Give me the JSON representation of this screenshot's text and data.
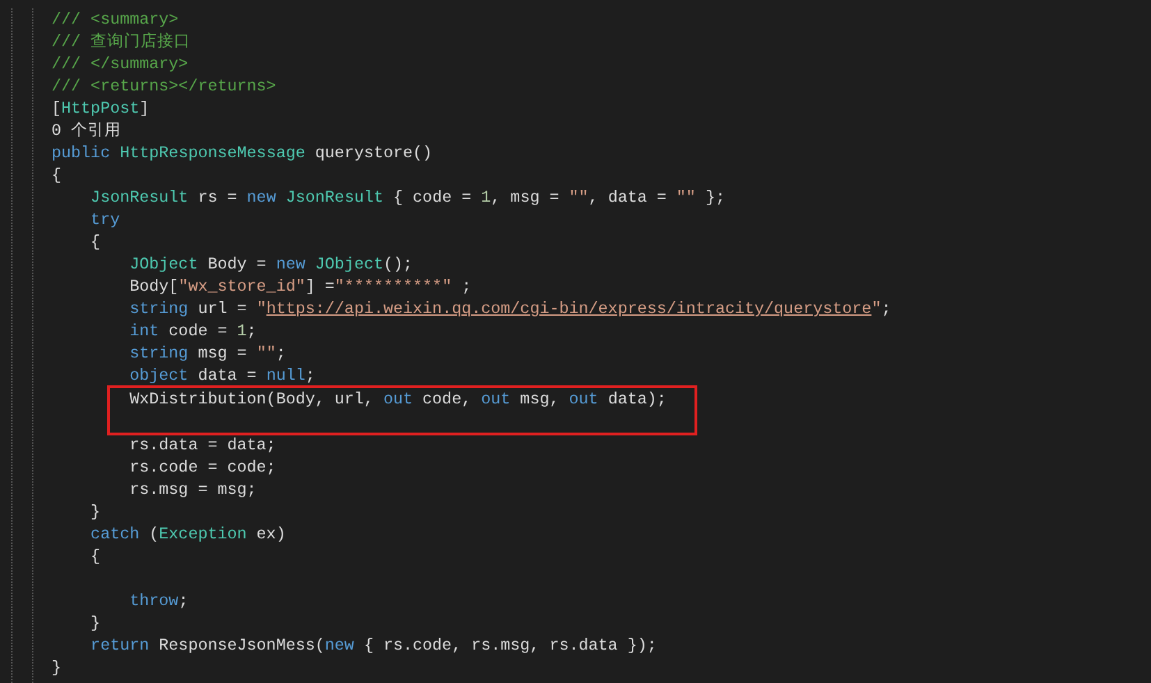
{
  "editor": {
    "lines": [
      {
        "kind": "code",
        "tokens": [
          {
            "kind": "comment",
            "text": "/// <summary>"
          }
        ]
      },
      {
        "kind": "code",
        "tokens": [
          {
            "kind": "comment",
            "text": "/// 查询门店接口"
          }
        ]
      },
      {
        "kind": "code",
        "tokens": [
          {
            "kind": "comment",
            "text": "/// </summary>"
          }
        ]
      },
      {
        "kind": "code",
        "tokens": [
          {
            "kind": "comment",
            "text": "/// <returns></returns>"
          }
        ]
      },
      {
        "kind": "code",
        "tokens": [
          {
            "kind": "plain",
            "text": "["
          },
          {
            "kind": "type",
            "text": "HttpPost"
          },
          {
            "kind": "plain",
            "text": "]"
          }
        ]
      },
      {
        "kind": "codelens",
        "tokens": [
          {
            "kind": "plain",
            "text": "0 个引用"
          }
        ]
      },
      {
        "kind": "code",
        "tokens": [
          {
            "kind": "keyword",
            "text": "public "
          },
          {
            "kind": "type",
            "text": "HttpResponseMessage"
          },
          {
            "kind": "plain",
            "text": " querystore()"
          }
        ]
      },
      {
        "kind": "code",
        "tokens": [
          {
            "kind": "plain",
            "text": "{"
          }
        ]
      },
      {
        "kind": "code",
        "tokens": [
          {
            "kind": "type",
            "text": "    JsonResult"
          },
          {
            "kind": "plain",
            "text": " rs = "
          },
          {
            "kind": "keyword",
            "text": "new "
          },
          {
            "kind": "type",
            "text": "JsonResult"
          },
          {
            "kind": "plain",
            "text": " { code = "
          },
          {
            "kind": "number",
            "text": "1"
          },
          {
            "kind": "plain",
            "text": ", msg = "
          },
          {
            "kind": "string",
            "text": "\"\""
          },
          {
            "kind": "plain",
            "text": ", data = "
          },
          {
            "kind": "string",
            "text": "\"\""
          },
          {
            "kind": "plain",
            "text": " };"
          }
        ]
      },
      {
        "kind": "code",
        "tokens": [
          {
            "kind": "keyword",
            "text": "    try"
          }
        ]
      },
      {
        "kind": "code",
        "tokens": [
          {
            "kind": "plain",
            "text": "    {"
          }
        ]
      },
      {
        "kind": "code",
        "tokens": [
          {
            "kind": "type",
            "text": "        JObject"
          },
          {
            "kind": "plain",
            "text": " Body = "
          },
          {
            "kind": "keyword",
            "text": "new "
          },
          {
            "kind": "type",
            "text": "JObject"
          },
          {
            "kind": "plain",
            "text": "();"
          }
        ]
      },
      {
        "kind": "code",
        "tokens": [
          {
            "kind": "plain",
            "text": "        Body["
          },
          {
            "kind": "string",
            "text": "\"wx_store_id\""
          },
          {
            "kind": "plain",
            "text": "] ="
          },
          {
            "kind": "string",
            "text": "\"**********\""
          },
          {
            "kind": "plain",
            "text": " ;"
          }
        ]
      },
      {
        "kind": "code",
        "tokens": [
          {
            "kind": "keyword",
            "text": "        string"
          },
          {
            "kind": "plain",
            "text": " url = "
          },
          {
            "kind": "string",
            "text": "\""
          },
          {
            "kind": "link",
            "text": "https://api.weixin.qq.com/cgi-bin/express/intracity/querystore"
          },
          {
            "kind": "string",
            "text": "\""
          },
          {
            "kind": "plain",
            "text": ";"
          }
        ]
      },
      {
        "kind": "code",
        "tokens": [
          {
            "kind": "keyword",
            "text": "        int"
          },
          {
            "kind": "plain",
            "text": " code = "
          },
          {
            "kind": "number",
            "text": "1"
          },
          {
            "kind": "plain",
            "text": ";"
          }
        ]
      },
      {
        "kind": "code",
        "tokens": [
          {
            "kind": "keyword",
            "text": "        string"
          },
          {
            "kind": "plain",
            "text": " msg = "
          },
          {
            "kind": "string",
            "text": "\"\""
          },
          {
            "kind": "plain",
            "text": ";"
          }
        ]
      },
      {
        "kind": "code",
        "tokens": [
          {
            "kind": "keyword",
            "text": "        object"
          },
          {
            "kind": "plain",
            "text": " data = "
          },
          {
            "kind": "keyword",
            "text": "null"
          },
          {
            "kind": "plain",
            "text": ";"
          }
        ]
      },
      {
        "kind": "code",
        "boxed": true,
        "tokens": [
          {
            "kind": "plain",
            "text": "        WxDistribution(Body, url, "
          },
          {
            "kind": "keyword",
            "text": "out"
          },
          {
            "kind": "plain",
            "text": " code, "
          },
          {
            "kind": "keyword",
            "text": "out"
          },
          {
            "kind": "plain",
            "text": " msg, "
          },
          {
            "kind": "keyword",
            "text": "out"
          },
          {
            "kind": "plain",
            "text": " data);"
          }
        ]
      },
      {
        "kind": "blank",
        "boxed": true
      },
      {
        "kind": "code",
        "tokens": [
          {
            "kind": "plain",
            "text": "        rs.data = data;"
          }
        ]
      },
      {
        "kind": "code",
        "tokens": [
          {
            "kind": "plain",
            "text": "        rs.code = code;"
          }
        ]
      },
      {
        "kind": "code",
        "tokens": [
          {
            "kind": "plain",
            "text": "        rs.msg = msg;"
          }
        ]
      },
      {
        "kind": "code",
        "tokens": [
          {
            "kind": "plain",
            "text": "    }"
          }
        ]
      },
      {
        "kind": "code",
        "tokens": [
          {
            "kind": "keyword",
            "text": "    catch"
          },
          {
            "kind": "plain",
            "text": " ("
          },
          {
            "kind": "type",
            "text": "Exception"
          },
          {
            "kind": "plain",
            "text": " ex)"
          }
        ]
      },
      {
        "kind": "code",
        "tokens": [
          {
            "kind": "plain",
            "text": "    {"
          }
        ]
      },
      {
        "kind": "blank"
      },
      {
        "kind": "code",
        "tokens": [
          {
            "kind": "keyword",
            "text": "        throw"
          },
          {
            "kind": "plain",
            "text": ";"
          }
        ]
      },
      {
        "kind": "code",
        "tokens": [
          {
            "kind": "plain",
            "text": "    }"
          }
        ]
      },
      {
        "kind": "code",
        "tokens": [
          {
            "kind": "keyword",
            "text": "    return"
          },
          {
            "kind": "plain",
            "text": " ResponseJsonMess("
          },
          {
            "kind": "keyword",
            "text": "new"
          },
          {
            "kind": "plain",
            "text": " { rs.code, rs.msg, rs.data });"
          }
        ]
      },
      {
        "kind": "code",
        "tokens": [
          {
            "kind": "plain",
            "text": "}"
          }
        ]
      }
    ]
  }
}
